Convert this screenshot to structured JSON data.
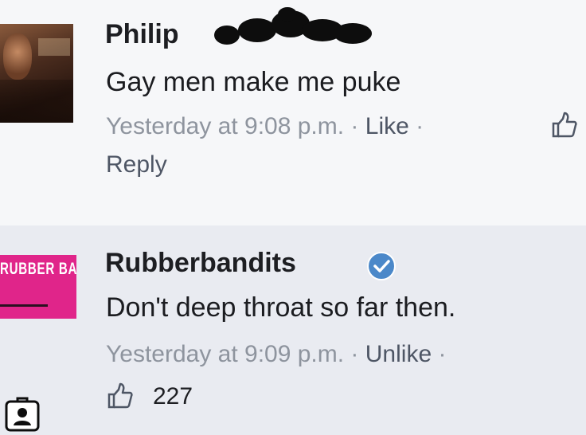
{
  "comments": [
    {
      "author": "Philip",
      "text": "Gay men make me puke",
      "timestamp": "Yesterday at 9:08 p.m.",
      "separator": "·",
      "action_label": "Like",
      "reply_label": "Reply",
      "avatar_icon": "profile-photo"
    },
    {
      "author": "Rubberbandits",
      "verified": true,
      "text": "Don't deep throat so far then.",
      "timestamp": "Yesterday at 9:09 p.m.",
      "separator": "·",
      "action_label": "Unlike",
      "like_count": "227",
      "avatar_logo": "RUBBER BANDITS",
      "avatar_color": "#e0258a"
    }
  ],
  "colors": {
    "verified_badge": "#4b88c9",
    "meta_text": "#8e949e",
    "action_text": "#4e5665"
  },
  "icons": [
    "thumbs-up-icon",
    "verified-badge-icon",
    "profile-icon"
  ]
}
